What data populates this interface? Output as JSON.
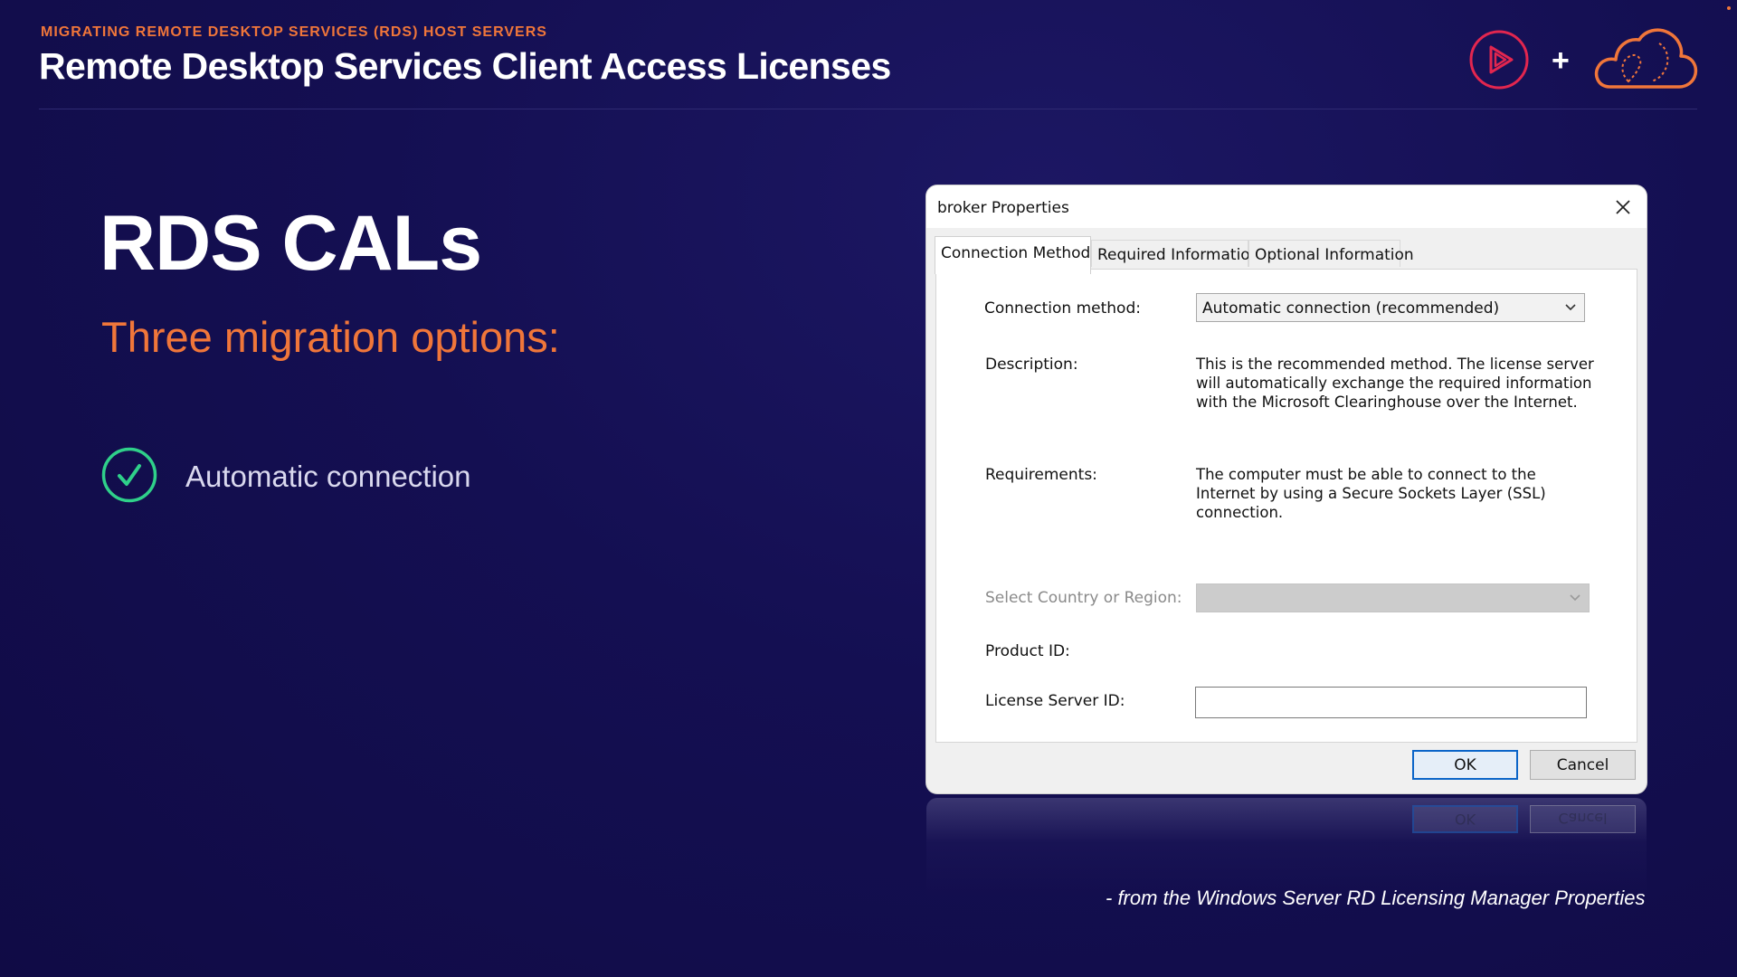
{
  "header": {
    "eyebrow": "MIGRATING REMOTE DESKTOP SERVICES (RDS) HOST SERVERS",
    "title": "Remote Desktop Services Client Access Licenses",
    "logos": [
      "play-icon",
      "cloud-icon"
    ],
    "plus": "+"
  },
  "slide": {
    "title": "RDS CALs",
    "subtitle": "Three migration options:",
    "options": [
      {
        "label": "Automatic connection",
        "icon": "check-circle-icon"
      }
    ]
  },
  "dialog": {
    "title": "broker Properties",
    "tabs": [
      {
        "label": "Connection Method",
        "active": true
      },
      {
        "label": "Required Information",
        "active": false
      },
      {
        "label": "Optional Information",
        "active": false
      }
    ],
    "connection_method_label": "Connection method:",
    "connection_method_value": "Automatic connection (recommended)",
    "description_label": "Description:",
    "description_text": "This is the recommended method. The license server will automatically exchange the required information with the Microsoft Clearinghouse over the Internet.",
    "requirements_label": "Requirements:",
    "requirements_text": "The computer must be able to connect to the Internet by using a Secure Sockets Layer (SSL) connection.",
    "country_label": "Select Country or Region:",
    "country_value": "",
    "product_id_label": "Product ID:",
    "product_id_value": "",
    "license_server_id_label": "License Server ID:",
    "license_server_id_value": "",
    "ok_label": "OK",
    "cancel_label": "Cancel"
  },
  "caption": "- from the Windows Server RD Licensing Manager Properties",
  "colors": {
    "background": "#140f52",
    "accent": "#f0763a",
    "check": "#2fd08a",
    "play_logo": "#e3264f",
    "cloud_logo": "#f0763a"
  }
}
